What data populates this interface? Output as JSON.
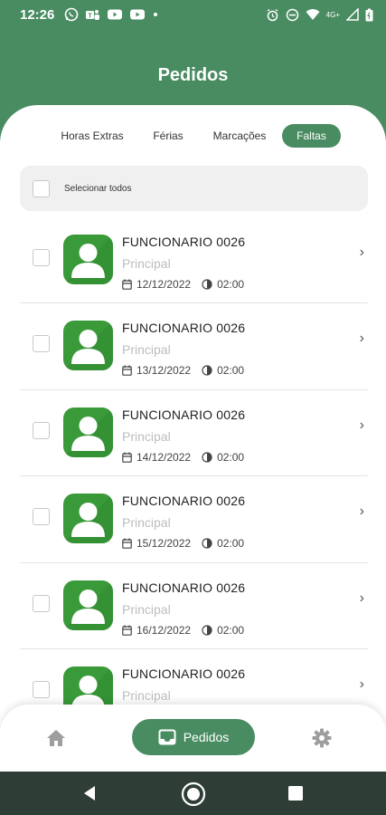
{
  "status_bar": {
    "time": "12:26",
    "network": "4G+"
  },
  "header": {
    "title": "Pedidos"
  },
  "tabs": [
    {
      "label": "Horas Extras",
      "active": false
    },
    {
      "label": "Férias",
      "active": false
    },
    {
      "label": "Marcações",
      "active": false
    },
    {
      "label": "Faltas",
      "active": true
    }
  ],
  "select_all": {
    "label": "Selecionar todos"
  },
  "requests": [
    {
      "name": "FUNCIONARIO 0026",
      "role": "Principal",
      "date": "12/12/2022",
      "hours": "02:00"
    },
    {
      "name": "FUNCIONARIO 0026",
      "role": "Principal",
      "date": "13/12/2022",
      "hours": "02:00"
    },
    {
      "name": "FUNCIONARIO 0026",
      "role": "Principal",
      "date": "14/12/2022",
      "hours": "02:00"
    },
    {
      "name": "FUNCIONARIO 0026",
      "role": "Principal",
      "date": "15/12/2022",
      "hours": "02:00"
    },
    {
      "name": "FUNCIONARIO 0026",
      "role": "Principal",
      "date": "16/12/2022",
      "hours": "02:00"
    },
    {
      "name": "FUNCIONARIO 0026",
      "role": "Principal",
      "date": "",
      "hours": ""
    }
  ],
  "bottom_nav": {
    "home_icon": "home-icon",
    "pedidos_label": "Pedidos",
    "pedidos_icon": "inbox-icon",
    "settings_icon": "gear-icon"
  },
  "colors": {
    "primary": "#4a8c62",
    "avatar_bg": "#3a9a3a",
    "system_nav": "#2e3e36"
  }
}
